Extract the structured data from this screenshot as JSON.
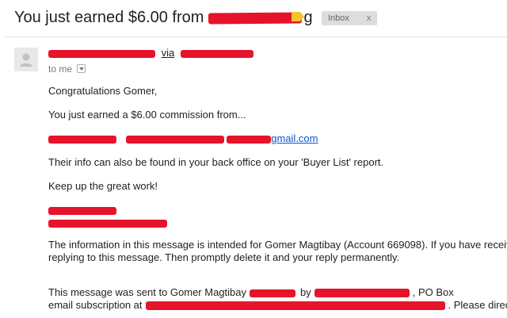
{
  "subject": {
    "prefix": "You just earned $6.00 from",
    "suffix": "g"
  },
  "label": {
    "name": "Inbox",
    "remove": "x"
  },
  "sender": {
    "via": "via"
  },
  "recipient": {
    "to_text": "to me"
  },
  "message": {
    "greeting": "Congratulations Gomer,",
    "commission": "You just earned a $6.00 commission from...",
    "contact_link_tail": "gmail.com",
    "info": "Their info can also be found in your back office on your 'Buyer List' report.",
    "keep_up": "Keep up the great work!",
    "disclaimer_line1": "The information in this message is intended for Gomer Magtibay (Account 669098). If you have received",
    "disclaimer_line2": "replying to this message. Then promptly delete it and your reply permanently.",
    "footer_line1_a": "This message was sent to Gomer Magtibay",
    "footer_line1_b": "by",
    "footer_line1_c": ", PO Box",
    "footer_line2_a": "email subscription at",
    "footer_line2_b": ". Please direct"
  },
  "colors": {
    "redaction": "#e5142b",
    "link": "#1155cc",
    "label_bg": "#dddddd",
    "important_marker": "#f4c430"
  },
  "icons": {
    "avatar": "default-user-avatar-icon",
    "important": "label-important-marker-icon",
    "dropdown": "chevron-down-icon"
  }
}
